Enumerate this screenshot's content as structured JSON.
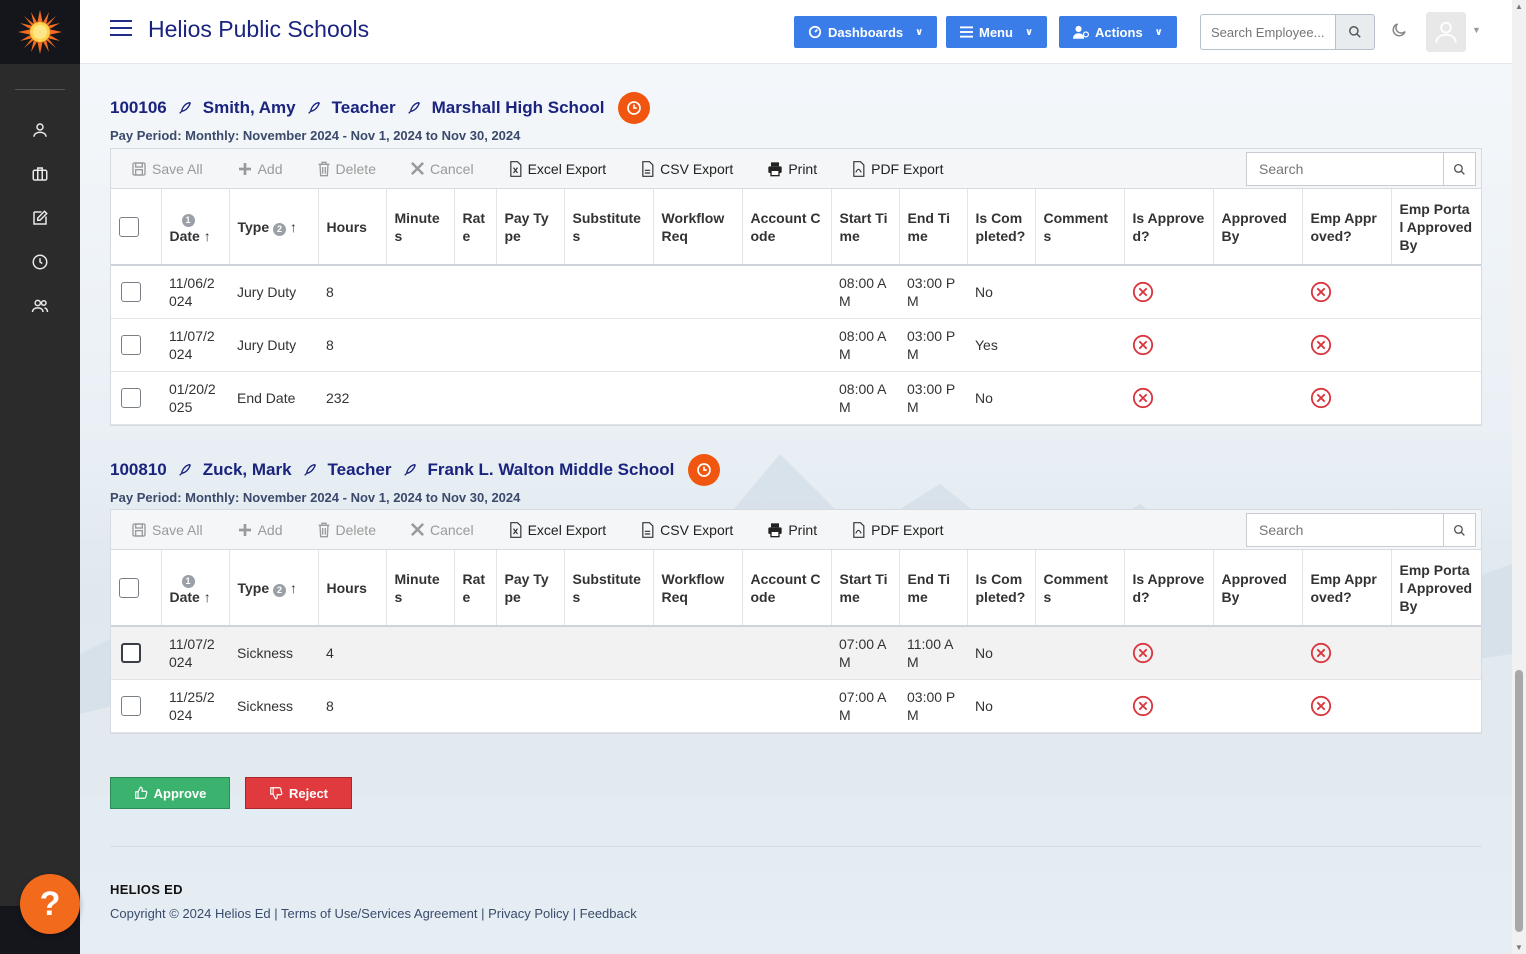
{
  "header": {
    "app_title": "Helios Public Schools",
    "dashboards_label": "Dashboards",
    "menu_label": "Menu",
    "actions_label": "Actions",
    "search_placeholder": "Search Employee..."
  },
  "sidebar": {
    "items": [
      {
        "icon": "user-icon"
      },
      {
        "icon": "briefcase-icon"
      },
      {
        "icon": "edit-icon"
      },
      {
        "icon": "clock-icon"
      },
      {
        "icon": "users-icon"
      }
    ]
  },
  "toolbar": {
    "save_all": "Save All",
    "add": "Add",
    "delete": "Delete",
    "cancel": "Cancel",
    "excel_export": "Excel Export",
    "csv_export": "CSV Export",
    "print": "Print",
    "pdf_export": "PDF Export",
    "search_placeholder": "Search"
  },
  "columns": [
    "Date",
    "Type",
    "Hours",
    "Minutes",
    "Rate",
    "Pay Type",
    "Substitutes",
    "Workflow Req",
    "Account Code",
    "Start Time",
    "End Time",
    "Is Completed?",
    "Comments",
    "Is Approved?",
    "Approved By",
    "Emp Approved?",
    "Emp Portal Approved By"
  ],
  "sort_badges": {
    "date": "1",
    "type": "2"
  },
  "employees": [
    {
      "id": "100106",
      "name": "Smith, Amy",
      "position": "Teacher",
      "school": "Marshall High School",
      "pay_period": "Pay Period: Monthly: November 2024 - Nov 1, 2024 to Nov 30, 2024",
      "rows": [
        {
          "date": "11/06/2024",
          "type": "Jury Duty",
          "hours": "8",
          "start": "08:00 AM",
          "end": "03:00 PM",
          "completed": "No"
        },
        {
          "date": "11/07/2024",
          "type": "Jury Duty",
          "hours": "8",
          "start": "08:00 AM",
          "end": "03:00 PM",
          "completed": "Yes"
        },
        {
          "date": "01/20/2025",
          "type": "End Date",
          "hours": "232",
          "start": "08:00 AM",
          "end": "03:00 PM",
          "completed": "No"
        }
      ]
    },
    {
      "id": "100810",
      "name": "Zuck, Mark",
      "position": "Teacher",
      "school": "Frank L. Walton Middle School",
      "pay_period": "Pay Period: Monthly: November 2024 - Nov 1, 2024 to Nov 30, 2024",
      "rows": [
        {
          "date": "11/07/2024",
          "type": "Sickness",
          "hours": "4",
          "start": "07:00 AM",
          "end": "11:00 AM",
          "completed": "No"
        },
        {
          "date": "11/25/2024",
          "type": "Sickness",
          "hours": "8",
          "start": "07:00 AM",
          "end": "03:00 PM",
          "completed": "No"
        }
      ]
    }
  ],
  "buttons": {
    "approve": "Approve",
    "reject": "Reject"
  },
  "footer": {
    "brand": "HELIOS ED",
    "copyright": "Copyright © 2024 Helios Ed",
    "terms": "Terms of Use/Services Agreement",
    "privacy": "Privacy Policy",
    "feedback": "Feedback"
  },
  "help_label": "?",
  "colors": {
    "accent": "#3b7de8",
    "title": "#1a237e",
    "approve": "#3bb26e",
    "reject": "#e0393e",
    "badge": "#f0560f",
    "x_icon": "#d9363e"
  }
}
